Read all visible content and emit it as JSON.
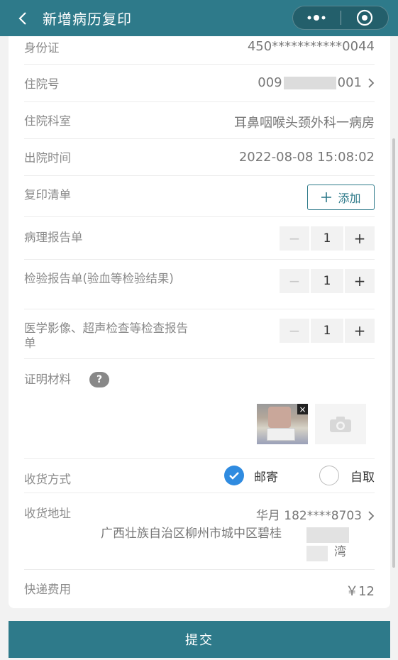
{
  "header": {
    "title": "新增病历复印"
  },
  "fields": {
    "id_card": {
      "label": "身份证",
      "value": "450***********0044"
    },
    "inpatient_no": {
      "label": "住院号",
      "value_prefix": "009",
      "value_suffix": "001"
    },
    "department": {
      "label": "住院科室",
      "value": "耳鼻咽喉头颈外科一病房"
    },
    "discharge_time": {
      "label": "出院时间",
      "value": "2022-08-08 15:08:02"
    },
    "copy_list": {
      "label": "复印清单",
      "add_label": "添加"
    },
    "items": [
      {
        "label": "病理报告单",
        "qty": "1"
      },
      {
        "label": "检验报告单(验血等检验结果)",
        "qty": "1"
      },
      {
        "label": "医学影像、超声检查等检查报告单",
        "qty": "1"
      }
    ],
    "proof": {
      "label": "证明材料",
      "help": "?"
    },
    "delivery": {
      "label": "收货方式",
      "option_mail": "邮寄",
      "option_pickup": "自取",
      "selected": "邮寄"
    },
    "address": {
      "label": "收货地址",
      "contact": "华月 182****8703",
      "line1": "广西壮族自治区柳州市城中区碧桂",
      "line2": "湾"
    },
    "express_fee": {
      "label": "快递费用",
      "value": "￥12"
    }
  },
  "submit_label": "提交",
  "colors": {
    "primary": "#2e7a8a",
    "radio_on": "#2f8be0"
  },
  "icons": [
    "back-arrow-icon",
    "more-dots-icon",
    "target-circle-icon",
    "chevron-right-icon",
    "plus-icon",
    "minus-icon",
    "help-icon",
    "close-icon",
    "camera-icon",
    "check-icon"
  ]
}
